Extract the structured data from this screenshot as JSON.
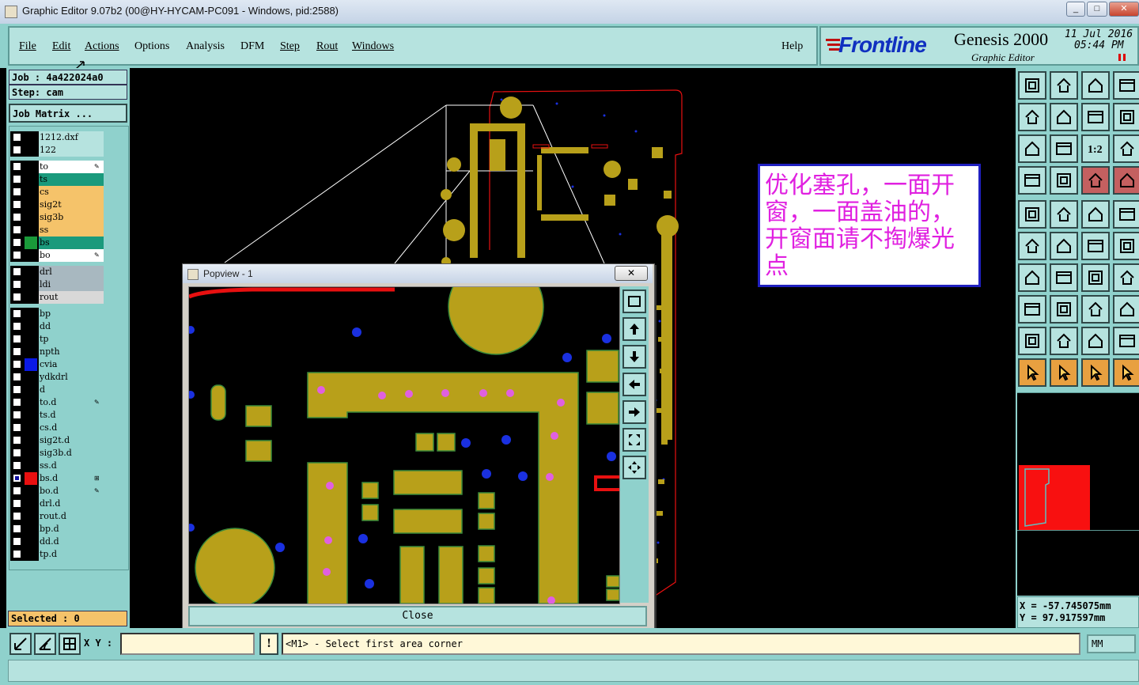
{
  "window": {
    "title": "Graphic Editor 9.07b2 (00@HY-HYCAM-PC091 - Windows, pid:2588)",
    "min": "▭",
    "max": "□",
    "close": "✕"
  },
  "menu": {
    "items": [
      "File",
      "Edit",
      "Actions",
      "Options",
      "Analysis",
      "DFM",
      "Step",
      "Rout",
      "Windows"
    ],
    "help": "Help"
  },
  "brand": {
    "logo": "Frontline",
    "product": "Genesis 2000",
    "subtitle": "Graphic Editor",
    "date": "11 Jul 2016",
    "time": "05:44 PM"
  },
  "job": {
    "job_label": "Job : 4a422024a0",
    "step_label": "Step: cam",
    "matrix_button": "Job Matrix ..."
  },
  "layers": [
    {
      "name": "1212.dxf",
      "color": "#000000",
      "bg": "#b6e3df"
    },
    {
      "name": "122",
      "color": "#000000",
      "bg": "#b6e3df"
    },
    {
      "name": "to",
      "color": "#000000",
      "bg": "#ffffff",
      "edit": true
    },
    {
      "name": "ts",
      "color": "#000000",
      "bg": "#1a9a7c"
    },
    {
      "name": "cs",
      "color": "#000000",
      "bg": "#f5c36a"
    },
    {
      "name": "sig2t",
      "color": "#000000",
      "bg": "#f5c36a"
    },
    {
      "name": "sig3b",
      "color": "#000000",
      "bg": "#f5c36a"
    },
    {
      "name": "ss",
      "color": "#000000",
      "bg": "#f5c36a"
    },
    {
      "name": "bs",
      "color": "#1a9a3a",
      "bg": "#1a9a7c"
    },
    {
      "name": "bo",
      "color": "#000000",
      "bg": "#ffffff",
      "edit": true
    },
    {
      "name": "drl",
      "color": "#000000",
      "bg": "#a8b8c0"
    },
    {
      "name": "ldi",
      "color": "#000000",
      "bg": "#a8b8c0"
    },
    {
      "name": "rout",
      "color": "#000000",
      "bg": "#d8d8d8"
    },
    {
      "name": "bp",
      "color": "#000000",
      "bg": "#8fd1cc"
    },
    {
      "name": "dd",
      "color": "#000000",
      "bg": "#8fd1cc"
    },
    {
      "name": "tp",
      "color": "#000000",
      "bg": "#8fd1cc"
    },
    {
      "name": "npth",
      "color": "#000000",
      "bg": "#8fd1cc"
    },
    {
      "name": "cvia",
      "color": "#0a1ae6",
      "bg": "#8fd1cc"
    },
    {
      "name": "ydkdrl",
      "color": "#000000",
      "bg": "#8fd1cc"
    },
    {
      "name": "d",
      "color": "#000000",
      "bg": "#8fd1cc"
    },
    {
      "name": "to.d",
      "color": "#000000",
      "bg": "#8fd1cc",
      "edit": true
    },
    {
      "name": "ts.d",
      "color": "#000000",
      "bg": "#8fd1cc"
    },
    {
      "name": "cs.d",
      "color": "#000000",
      "bg": "#8fd1cc"
    },
    {
      "name": "sig2t.d",
      "color": "#000000",
      "bg": "#8fd1cc"
    },
    {
      "name": "sig3b.d",
      "color": "#000000",
      "bg": "#8fd1cc"
    },
    {
      "name": "ss.d",
      "color": "#000000",
      "bg": "#8fd1cc"
    },
    {
      "name": "bs.d",
      "color": "#e81010",
      "bg": "#8fd1cc",
      "checked": true,
      "ref": true
    },
    {
      "name": "bo.d",
      "color": "#000000",
      "bg": "#8fd1cc",
      "edit": true
    },
    {
      "name": "drl.d",
      "color": "#000000",
      "bg": "#8fd1cc"
    },
    {
      "name": "rout.d",
      "color": "#000000",
      "bg": "#8fd1cc"
    },
    {
      "name": "bp.d",
      "color": "#000000",
      "bg": "#8fd1cc"
    },
    {
      "name": "dd.d",
      "color": "#000000",
      "bg": "#8fd1cc"
    },
    {
      "name": "tp.d",
      "color": "#000000",
      "bg": "#8fd1cc"
    }
  ],
  "selected": {
    "label": "Selected : 0"
  },
  "annotation": {
    "text": "优化塞孔，一面开窗，一面盖油的，开窗面请不掏爆光点"
  },
  "popview": {
    "title": "Popview - 1",
    "close_button": "Close",
    "close_x": "✕"
  },
  "coords": {
    "x": "X = -57.745075mm",
    "y": "Y = 97.917597mm"
  },
  "statusbar": {
    "xy_label": "X Y :",
    "xy_value": "",
    "prompt": "<M1> - Select first area corner",
    "units": "MM",
    "warn_icon": "!"
  },
  "toolbar": {
    "ratio_label": "1:2"
  },
  "colors": {
    "panel": "#8fd1cc",
    "panel_light": "#b6e3df",
    "copper": "#b8a01a",
    "via": "#1a30e0",
    "pad_hole": "#e060e0",
    "board_outline": "#e81010"
  }
}
